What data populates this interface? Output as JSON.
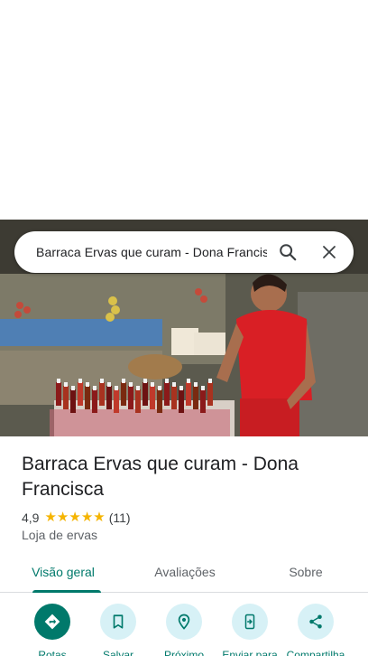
{
  "search": {
    "query": "Barraca Ervas que curam - Dona Francisca",
    "search_icon": "search-icon",
    "clear_icon": "close-icon"
  },
  "place": {
    "name": "Barraca Ervas que curam - Dona Francisca",
    "rating": "4,9",
    "stars": 5,
    "review_count": "(11)",
    "category": "Loja de ervas"
  },
  "tabs": [
    {
      "label": "Visão geral",
      "active": true
    },
    {
      "label": "Avaliações",
      "active": false
    },
    {
      "label": "Sobre",
      "active": false
    }
  ],
  "actions": [
    {
      "label": "Rotas",
      "icon": "directions-icon"
    },
    {
      "label": "Salvar",
      "icon": "bookmark-icon"
    },
    {
      "label": "Próximo",
      "icon": "nearby-icon"
    },
    {
      "label": "Enviar para",
      "icon": "send-to-phone-icon"
    },
    {
      "label": "Compartilha",
      "icon": "share-icon"
    }
  ],
  "colors": {
    "accent": "#00796b",
    "star": "#f5b400",
    "action_bg": "#d7f1f6"
  }
}
